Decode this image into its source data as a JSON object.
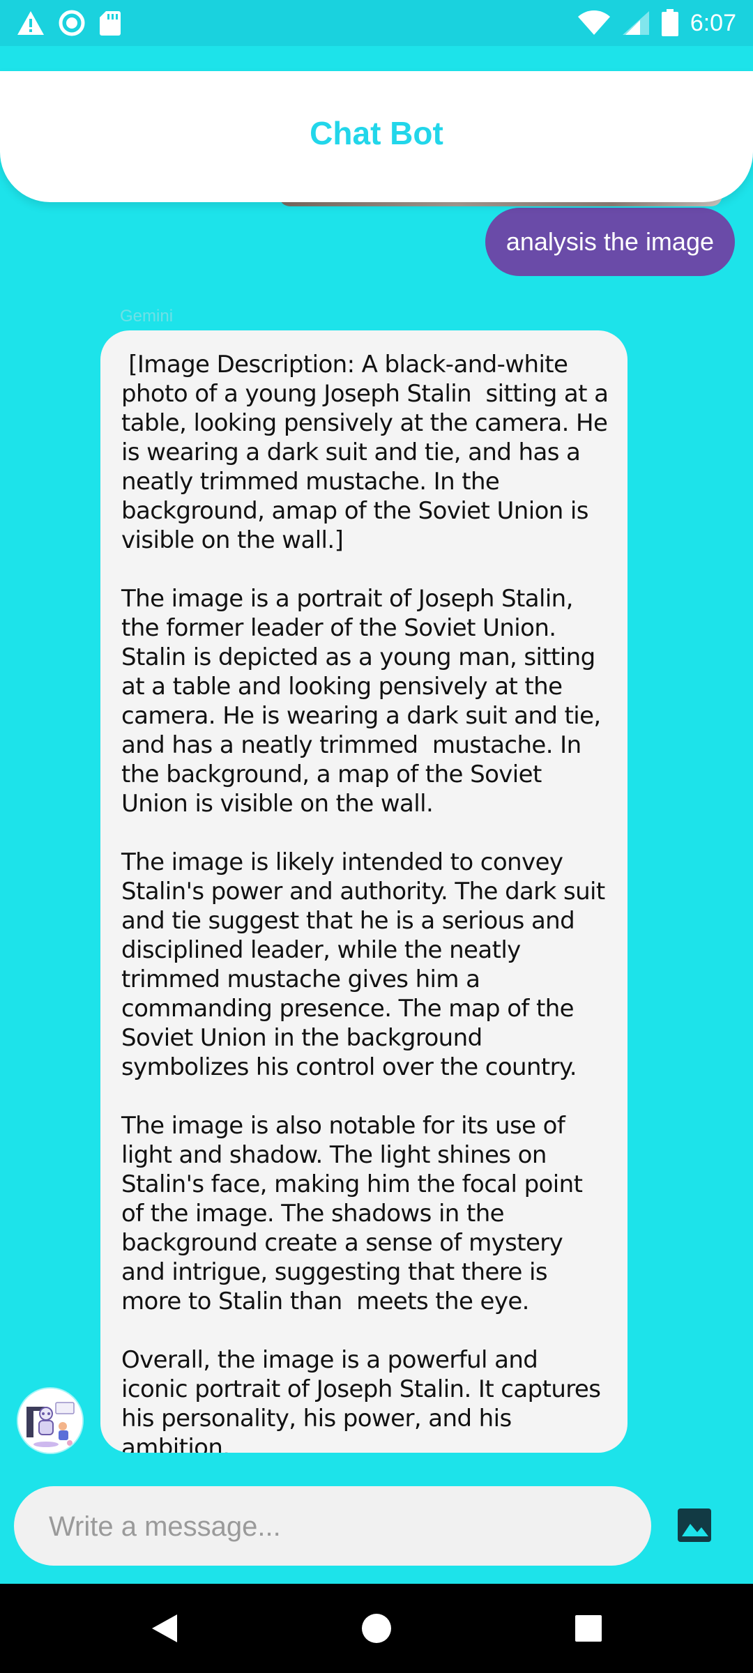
{
  "status_bar": {
    "time": "6:07",
    "left_icons": [
      "warning-icon",
      "circle-icon",
      "sd-card-icon"
    ],
    "right_icons": [
      "wifi-icon",
      "signal-icon",
      "battery-icon"
    ]
  },
  "header": {
    "title": "Chat Bot"
  },
  "messages": {
    "user_message": "analysis the image",
    "sender_name": "Gemini",
    "bot_reply": " [Image Description: A black-and-white photo of a young Joseph Stalin  sitting at a table, looking pensively at the camera. He is wearing a dark suit and tie, and has a neatly trimmed mustache. In the background, amap of the Soviet Union is visible on the wall.]\n\nThe image is a portrait of Joseph Stalin, the former leader of the Soviet Union. Stalin is depicted as a young man, sitting at a table and looking pensively at the camera. He is wearing a dark suit and tie, and has a neatly trimmed  mustache. In the background, a map of the Soviet Union is visible on the wall.\n\nThe image is likely intended to convey Stalin's power and authority. The dark suit and tie suggest that he is a serious and disciplined leader, while the neatly trimmed mustache gives him a commanding presence. The map of the Soviet Union in the background symbolizes his control over the country.\n\nThe image is also notable for its use of light and shadow. The light shines on Stalin's face, making him the focal point of the image. The shadows in the background create a sense of mystery and intrigue, suggesting that there is more to Stalin than  meets the eye.\n\nOverall, the image is a powerful and iconic portrait of Joseph Stalin. It captures his personality, his power, and his ambition."
  },
  "composer": {
    "placeholder": "Write a message...",
    "value": ""
  },
  "colors": {
    "background": "#1de3ea",
    "status_bar": "#1ad2de",
    "title": "#22d6ea",
    "user_bubble": "#6a4ba8",
    "bot_bubble": "#f4f4f4"
  },
  "nav": {
    "icons": [
      "back-icon",
      "home-icon",
      "recents-icon"
    ]
  }
}
